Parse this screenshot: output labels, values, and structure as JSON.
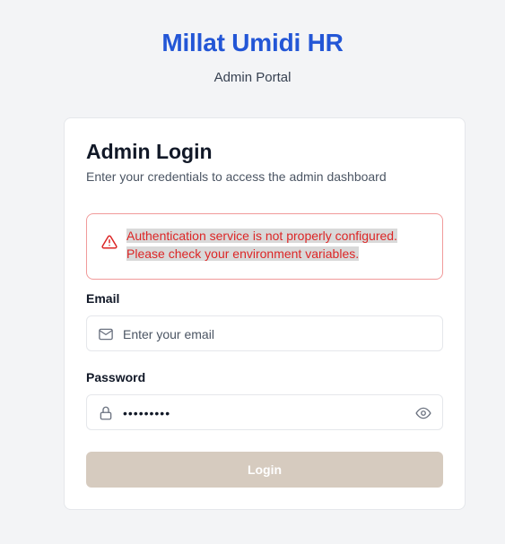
{
  "header": {
    "brand": "Millat Umidi HR",
    "subtitle": "Admin Portal"
  },
  "card": {
    "title": "Admin Login",
    "description": "Enter your credentials to access the admin dashboard"
  },
  "alert": {
    "icon": "warning-triangle-icon",
    "line1": "Authentication service is not properly configured.",
    "line2": "Please check your environment variables."
  },
  "form": {
    "email_label": "Email",
    "email_placeholder": "Enter your email",
    "email_value": "",
    "email_icon": "mail-icon",
    "password_label": "Password",
    "password_value": "•••••••••",
    "password_icon": "lock-icon",
    "password_toggle_icon": "eye-icon",
    "submit_label": "Login"
  },
  "colors": {
    "brand": "#2356d6",
    "error": "#dc2626",
    "button_disabled": "#d6cbbf"
  }
}
